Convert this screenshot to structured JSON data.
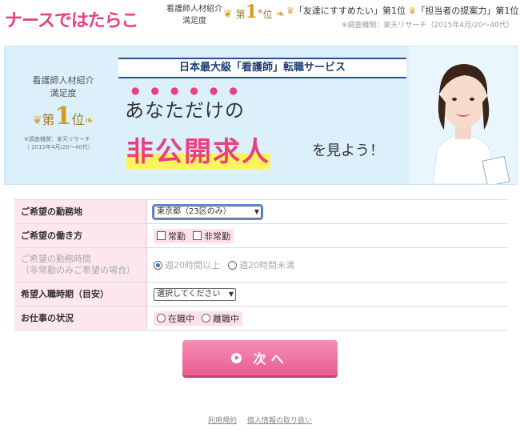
{
  "header": {
    "logo": "ナースではたらこ",
    "award_line1": "看護師人材紹介",
    "award_line2": "満足度",
    "rank_prefix": "第",
    "rank_num": "1",
    "rank_suffix": "位",
    "asterisk": "※",
    "top1": "「友達にすすめたい」第1位",
    "top2": "「担当者の提案力」第1位",
    "note": "※調査機関：楽天リサーチ（2015年4月/20～40代）"
  },
  "hero": {
    "left_line1": "看護師人材紹介",
    "left_line2": "満足度",
    "left_rank_prefix": "第",
    "left_rank_num": "1",
    "left_rank_suffix": "位",
    "left_note1": "※調査機関：楽天リサーチ",
    "left_note2": "（ 2015年4月/20～40代）",
    "service": "日本最大級「看護師」転職サービス",
    "headline1": "あなただけの",
    "headline2": "非公開求人",
    "headline3": "を見よう！"
  },
  "form": {
    "location_label": "ご希望の勤務地",
    "location_value": "東京都（23区のみ）",
    "style_label": "ご希望の働き方",
    "style_opt1": "常勤",
    "style_opt2": "非常勤",
    "hours_label_l1": "ご希望の勤務時間",
    "hours_label_l2": "（非常勤のみご希望の場合）",
    "hours_opt1": "週20時間以上",
    "hours_opt2": "週20時間未満",
    "start_label": "希望入職時期（目安）",
    "start_value": "選択してください",
    "status_label": "お仕事の状況",
    "status_opt1": "在職中",
    "status_opt2": "離職中"
  },
  "next_button": "次へ",
  "footer": {
    "terms": "利用規約",
    "privacy": "個人情報の取り扱い"
  },
  "colors": {
    "accent": "#e8417e",
    "hero_bg": "#dcf0fb",
    "label_bg": "#fde7ee",
    "service_blue": "#1e3f74"
  }
}
